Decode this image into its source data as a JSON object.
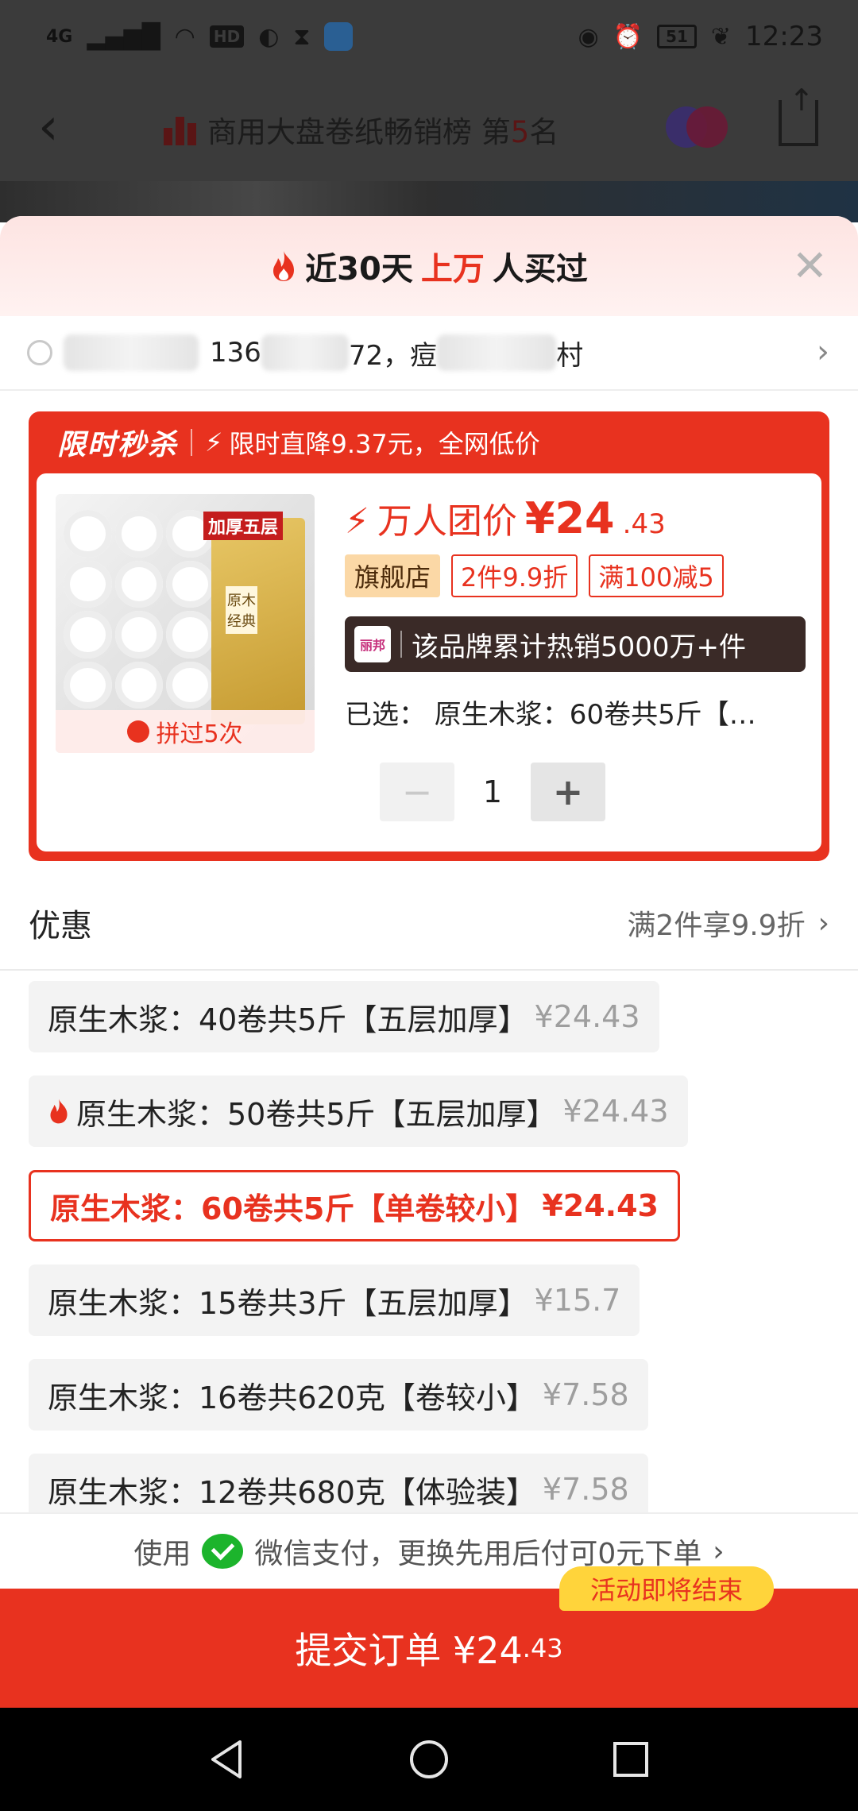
{
  "status_bar": {
    "network": "4G",
    "hd": "HD",
    "battery": "51",
    "time": "12:23"
  },
  "background_page": {
    "title": "商用大盘卷纸畅销榜 第",
    "rank": "5",
    "rank_suffix": "名"
  },
  "sheet": {
    "header": {
      "prefix": "近30天",
      "highlight": "上万",
      "suffix": "人买过"
    },
    "address": {
      "phone_start": "136",
      "phone_end": "72，痘",
      "mid": "",
      "tail": "村"
    },
    "flash_sale": {
      "logo": "限时秒杀",
      "desc": "限时直降9.37元，全网低价",
      "tried": "拼过5次",
      "image_tag": "加厚五层",
      "image_box_label": "原木经典",
      "price_label": "万人团价",
      "currency": "¥",
      "price_int": "24",
      "price_dec": ".43",
      "tags": [
        "旗舰店",
        "2件9.9折",
        "满100减5"
      ],
      "brand_logo": "丽邦",
      "brand_text": "该品牌累计热销5000万+件",
      "selected": "已选：  原生木浆：60卷共5斤【…",
      "quantity": "1"
    },
    "discount": {
      "label": "优惠",
      "value": "满2件享9.9折"
    },
    "options": [
      {
        "name": "原生木浆：40卷共5斤【五层加厚】",
        "price": "¥24.43",
        "hot": false,
        "selected": false
      },
      {
        "name": "原生木浆：50卷共5斤【五层加厚】",
        "price": "¥24.43",
        "hot": true,
        "selected": false
      },
      {
        "name": "原生木浆：60卷共5斤【单卷较小】",
        "price": "¥24.43",
        "hot": false,
        "selected": true
      },
      {
        "name": "原生木浆：15卷共3斤【五层加厚】",
        "price": "¥15.7",
        "hot": false,
        "selected": false
      },
      {
        "name": "原生木浆：16卷共620克【卷较小】",
        "price": "¥7.58",
        "hot": false,
        "selected": false
      },
      {
        "name": "原生木浆：12卷共680克【体验装】",
        "price": "¥7.58",
        "hot": false,
        "selected": false
      }
    ],
    "pay_hint": {
      "use": "使用",
      "text": "微信支付，更换先用后付可0元下单"
    },
    "ending_badge": "活动即将结束",
    "submit": {
      "label": "提交订单 ¥24",
      "decimal": ".43"
    }
  },
  "colors": {
    "accent": "#e8321f",
    "dim_bg": "#3b3b3b",
    "wechat": "#1cb42c",
    "badge": "#ffd43b"
  }
}
